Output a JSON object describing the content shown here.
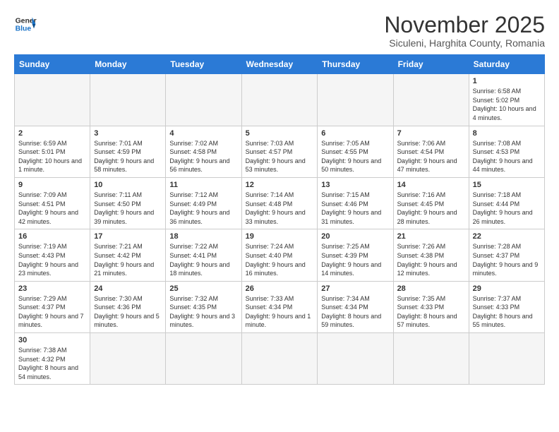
{
  "logo": {
    "line1": "General",
    "line2": "Blue"
  },
  "title": "November 2025",
  "subtitle": "Siculeni, Harghita County, Romania",
  "days_of_week": [
    "Sunday",
    "Monday",
    "Tuesday",
    "Wednesday",
    "Thursday",
    "Friday",
    "Saturday"
  ],
  "weeks": [
    [
      {
        "day": "",
        "info": ""
      },
      {
        "day": "",
        "info": ""
      },
      {
        "day": "",
        "info": ""
      },
      {
        "day": "",
        "info": ""
      },
      {
        "day": "",
        "info": ""
      },
      {
        "day": "",
        "info": ""
      },
      {
        "day": "1",
        "info": "Sunrise: 6:58 AM\nSunset: 5:02 PM\nDaylight: 10 hours and 4 minutes."
      }
    ],
    [
      {
        "day": "2",
        "info": "Sunrise: 6:59 AM\nSunset: 5:01 PM\nDaylight: 10 hours and 1 minute."
      },
      {
        "day": "3",
        "info": "Sunrise: 7:01 AM\nSunset: 4:59 PM\nDaylight: 9 hours and 58 minutes."
      },
      {
        "day": "4",
        "info": "Sunrise: 7:02 AM\nSunset: 4:58 PM\nDaylight: 9 hours and 56 minutes."
      },
      {
        "day": "5",
        "info": "Sunrise: 7:03 AM\nSunset: 4:57 PM\nDaylight: 9 hours and 53 minutes."
      },
      {
        "day": "6",
        "info": "Sunrise: 7:05 AM\nSunset: 4:55 PM\nDaylight: 9 hours and 50 minutes."
      },
      {
        "day": "7",
        "info": "Sunrise: 7:06 AM\nSunset: 4:54 PM\nDaylight: 9 hours and 47 minutes."
      },
      {
        "day": "8",
        "info": "Sunrise: 7:08 AM\nSunset: 4:53 PM\nDaylight: 9 hours and 44 minutes."
      }
    ],
    [
      {
        "day": "9",
        "info": "Sunrise: 7:09 AM\nSunset: 4:51 PM\nDaylight: 9 hours and 42 minutes."
      },
      {
        "day": "10",
        "info": "Sunrise: 7:11 AM\nSunset: 4:50 PM\nDaylight: 9 hours and 39 minutes."
      },
      {
        "day": "11",
        "info": "Sunrise: 7:12 AM\nSunset: 4:49 PM\nDaylight: 9 hours and 36 minutes."
      },
      {
        "day": "12",
        "info": "Sunrise: 7:14 AM\nSunset: 4:48 PM\nDaylight: 9 hours and 33 minutes."
      },
      {
        "day": "13",
        "info": "Sunrise: 7:15 AM\nSunset: 4:46 PM\nDaylight: 9 hours and 31 minutes."
      },
      {
        "day": "14",
        "info": "Sunrise: 7:16 AM\nSunset: 4:45 PM\nDaylight: 9 hours and 28 minutes."
      },
      {
        "day": "15",
        "info": "Sunrise: 7:18 AM\nSunset: 4:44 PM\nDaylight: 9 hours and 26 minutes."
      }
    ],
    [
      {
        "day": "16",
        "info": "Sunrise: 7:19 AM\nSunset: 4:43 PM\nDaylight: 9 hours and 23 minutes."
      },
      {
        "day": "17",
        "info": "Sunrise: 7:21 AM\nSunset: 4:42 PM\nDaylight: 9 hours and 21 minutes."
      },
      {
        "day": "18",
        "info": "Sunrise: 7:22 AM\nSunset: 4:41 PM\nDaylight: 9 hours and 18 minutes."
      },
      {
        "day": "19",
        "info": "Sunrise: 7:24 AM\nSunset: 4:40 PM\nDaylight: 9 hours and 16 minutes."
      },
      {
        "day": "20",
        "info": "Sunrise: 7:25 AM\nSunset: 4:39 PM\nDaylight: 9 hours and 14 minutes."
      },
      {
        "day": "21",
        "info": "Sunrise: 7:26 AM\nSunset: 4:38 PM\nDaylight: 9 hours and 12 minutes."
      },
      {
        "day": "22",
        "info": "Sunrise: 7:28 AM\nSunset: 4:37 PM\nDaylight: 9 hours and 9 minutes."
      }
    ],
    [
      {
        "day": "23",
        "info": "Sunrise: 7:29 AM\nSunset: 4:37 PM\nDaylight: 9 hours and 7 minutes."
      },
      {
        "day": "24",
        "info": "Sunrise: 7:30 AM\nSunset: 4:36 PM\nDaylight: 9 hours and 5 minutes."
      },
      {
        "day": "25",
        "info": "Sunrise: 7:32 AM\nSunset: 4:35 PM\nDaylight: 9 hours and 3 minutes."
      },
      {
        "day": "26",
        "info": "Sunrise: 7:33 AM\nSunset: 4:34 PM\nDaylight: 9 hours and 1 minute."
      },
      {
        "day": "27",
        "info": "Sunrise: 7:34 AM\nSunset: 4:34 PM\nDaylight: 8 hours and 59 minutes."
      },
      {
        "day": "28",
        "info": "Sunrise: 7:35 AM\nSunset: 4:33 PM\nDaylight: 8 hours and 57 minutes."
      },
      {
        "day": "29",
        "info": "Sunrise: 7:37 AM\nSunset: 4:33 PM\nDaylight: 8 hours and 55 minutes."
      }
    ],
    [
      {
        "day": "30",
        "info": "Sunrise: 7:38 AM\nSunset: 4:32 PM\nDaylight: 8 hours and 54 minutes."
      },
      {
        "day": "",
        "info": ""
      },
      {
        "day": "",
        "info": ""
      },
      {
        "day": "",
        "info": ""
      },
      {
        "day": "",
        "info": ""
      },
      {
        "day": "",
        "info": ""
      },
      {
        "day": "",
        "info": ""
      }
    ]
  ]
}
